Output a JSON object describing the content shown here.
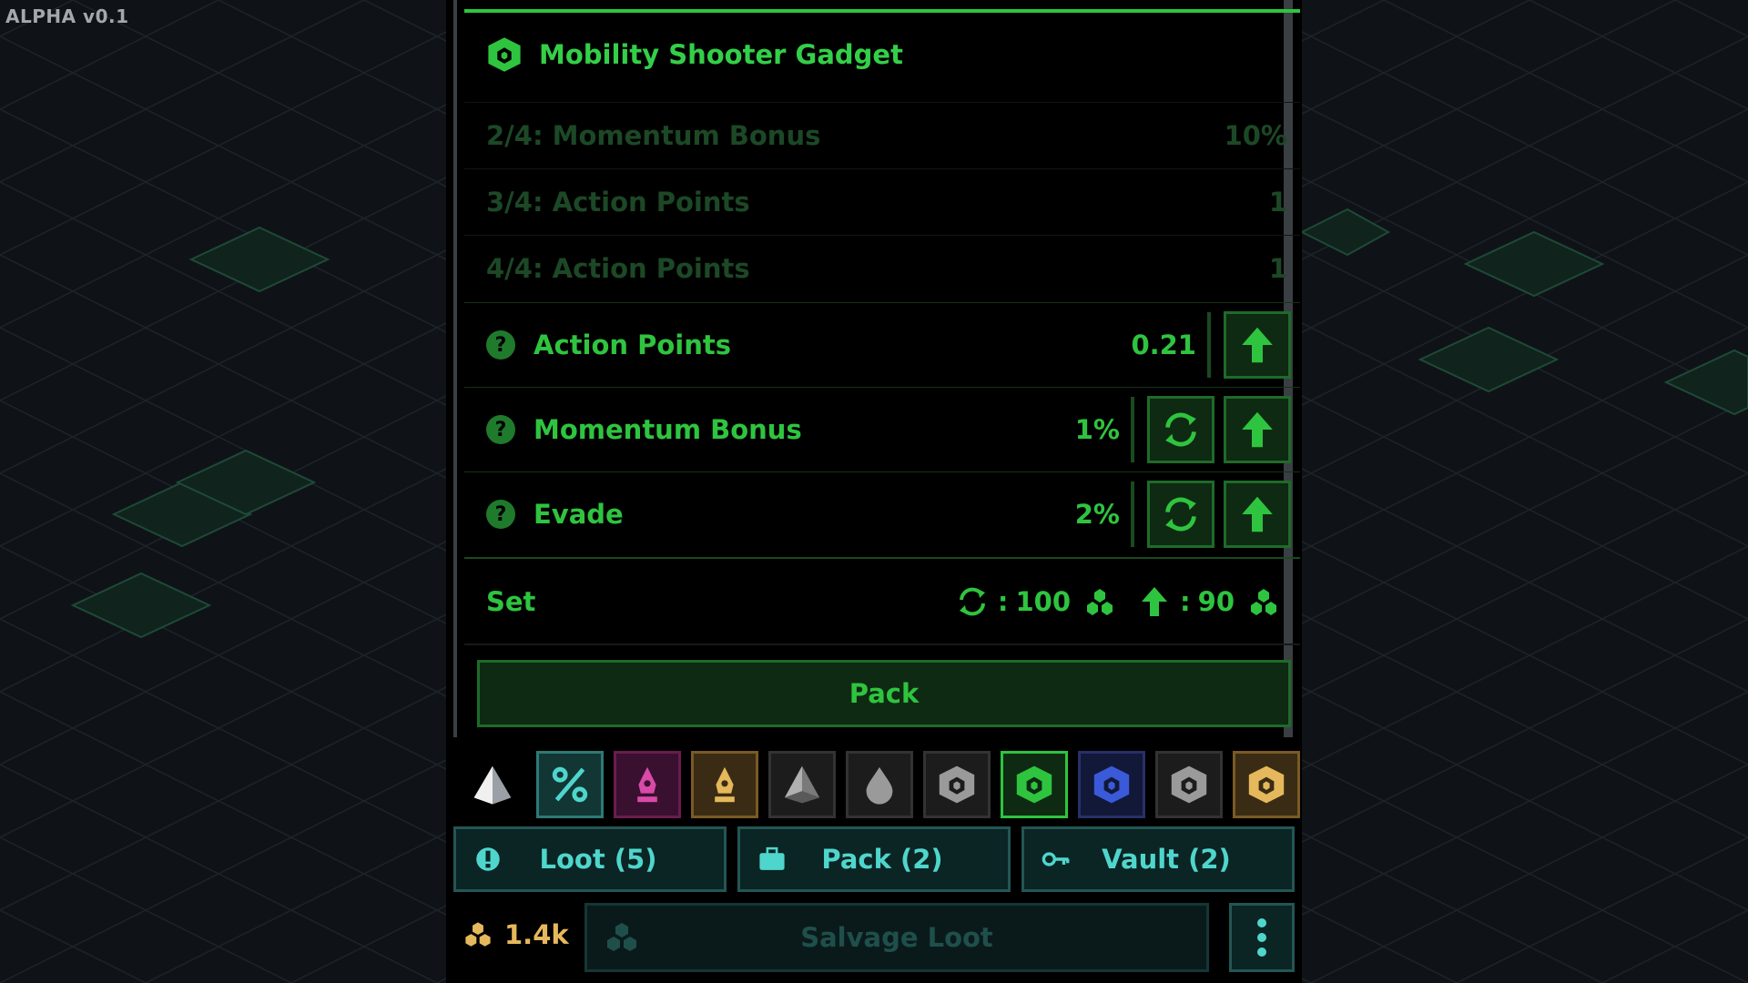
{
  "version": "ALPHA v0.1",
  "item": {
    "title": "Mobility Shooter Gadget",
    "icon": "gadget-cube-icon"
  },
  "locked_stats": [
    {
      "label": "2/4: Momentum Bonus",
      "value": "10%"
    },
    {
      "label": "3/4: Action Points",
      "value": "1"
    },
    {
      "label": "4/4: Action Points",
      "value": "1"
    }
  ],
  "stats": [
    {
      "name": "Action Points",
      "value": "0.21"
    },
    {
      "name": "Momentum Bonus",
      "value": "1%"
    },
    {
      "name": "Evade",
      "value": "2%"
    }
  ],
  "set": {
    "label": "Set",
    "reroll_cost": "100",
    "upgrade_cost": "90",
    "colon": ":"
  },
  "pack_button": "Pack",
  "filters": [
    {
      "icon": "pyramid-icon",
      "color": "#e0e0e0"
    },
    {
      "icon": "percent-icon",
      "color": "#4fd6cc"
    },
    {
      "icon": "pink-pen-icon",
      "color": "#d94aa8"
    },
    {
      "icon": "gold-pen-icon",
      "color": "#e6b85c"
    },
    {
      "icon": "gray-pyramid-icon",
      "color": "#9a9a9a"
    },
    {
      "icon": "drop-icon",
      "color": "#9a9a9a"
    },
    {
      "icon": "gray-cube-icon",
      "color": "#9a9a9a"
    },
    {
      "icon": "green-cube-icon",
      "color": "#2fc43f"
    },
    {
      "icon": "blue-cube-icon",
      "color": "#3a5ad9"
    },
    {
      "icon": "gray-cube-icon",
      "color": "#9a9a9a"
    },
    {
      "icon": "gold-cube-icon",
      "color": "#e6b85c"
    }
  ],
  "nav": {
    "loot": "Loot (5)",
    "pack": "Pack (2)",
    "vault": "Vault (2)"
  },
  "currency": "1.4k",
  "salvage": "Salvage Loot",
  "colors": {
    "accent": "#2fc43f",
    "teal": "#4fd6cc",
    "gold": "#e6b85c"
  }
}
